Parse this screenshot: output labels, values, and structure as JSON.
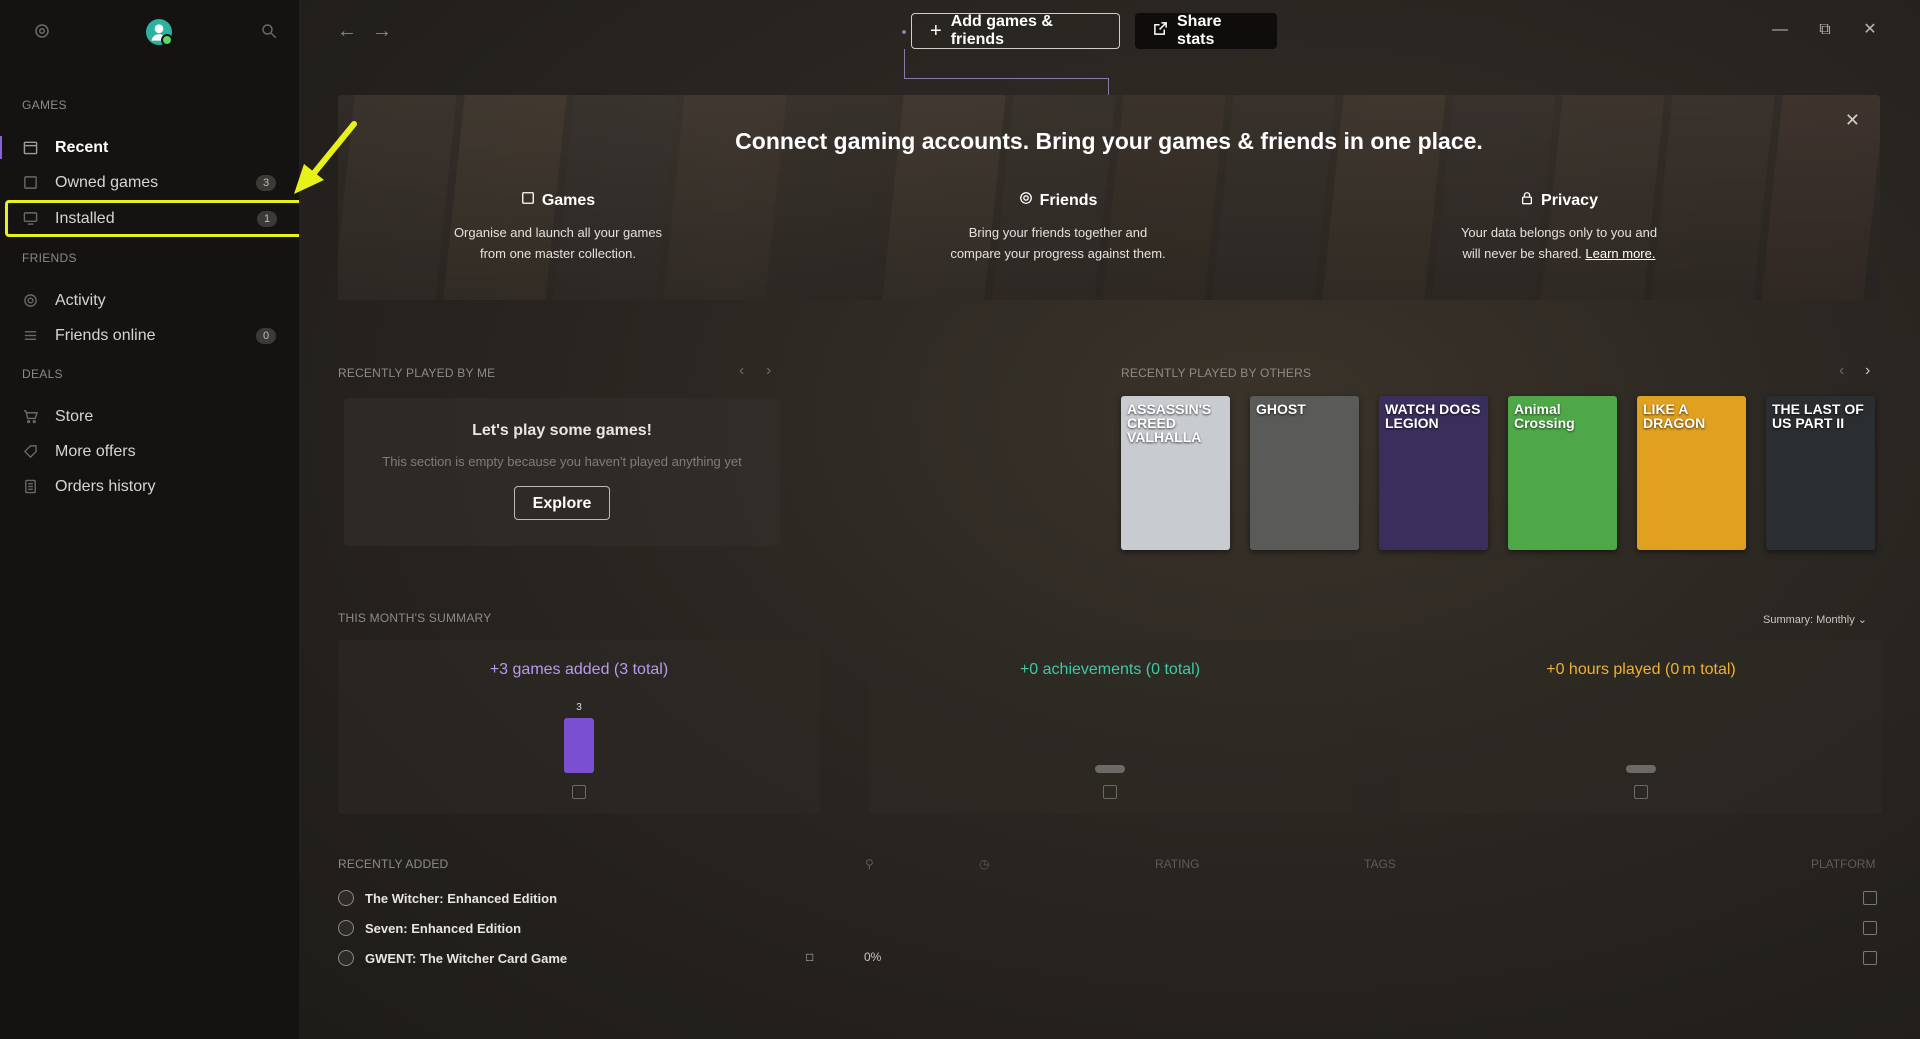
{
  "sidebar": {
    "sections": {
      "games": "GAMES",
      "friends": "FRIENDS",
      "deals": "DEALS"
    },
    "games": [
      {
        "label": "Recent",
        "icon": "calendar-icon"
      },
      {
        "label": "Owned games",
        "icon": "square-icon",
        "count": "3"
      },
      {
        "label": "Installed",
        "icon": "monitor-icon",
        "count": "1"
      }
    ],
    "friends": [
      {
        "label": "Activity",
        "icon": "activity-icon"
      },
      {
        "label": "Friends online",
        "icon": "list-icon",
        "count": "0"
      }
    ],
    "deals": [
      {
        "label": "Store",
        "icon": "cart-icon"
      },
      {
        "label": "More offers",
        "icon": "tag-icon"
      },
      {
        "label": "Orders history",
        "icon": "receipt-icon"
      }
    ]
  },
  "topbar": {
    "add_label": "Add games & friends",
    "share_label": "Share stats"
  },
  "banner": {
    "title": "Connect gaming accounts. Bring your games & friends in one place.",
    "features": [
      {
        "title": "Games",
        "line1": "Organise and launch all your games",
        "line2": "from one master collection."
      },
      {
        "title": "Friends",
        "line1": "Bring your friends together and",
        "line2": "compare your progress against them."
      },
      {
        "title": "Privacy",
        "line1": "Your data belongs only to you and",
        "line2": "will never be shared.",
        "link": "Learn more."
      }
    ]
  },
  "recently_played_me": {
    "heading": "RECENTLY PLAYED BY ME",
    "empty_title": "Let's play some games!",
    "empty_desc": "This section is empty because you haven't played anything yet",
    "button": "Explore"
  },
  "recently_played_others": {
    "heading": "RECENTLY PLAYED BY OTHERS",
    "covers": [
      {
        "title": "ASSASSIN'S CREED VALHALLA",
        "color": "#c8ccd0"
      },
      {
        "title": "GHOST",
        "color": "#5a5a58"
      },
      {
        "title": "WATCH DOGS LEGION",
        "color": "#3a2f5c"
      },
      {
        "title": "Animal Crossing",
        "color": "#4fa848"
      },
      {
        "title": "LIKE A DRAGON",
        "color": "#e0a020"
      },
      {
        "title": "THE LAST OF US PART II",
        "color": "#2a2e30"
      }
    ]
  },
  "summary": {
    "heading": "THIS MONTH'S SUMMARY",
    "selector": "Summary: Monthly",
    "cards": [
      {
        "title": "+3 games added (3 total)",
        "color": "#b89af0",
        "bar_value": "3"
      },
      {
        "title": "+0 achievements (0 total)",
        "color": "#3ec9a8"
      },
      {
        "title": "+0 hours played (0 m total)",
        "color": "#f0b030"
      }
    ]
  },
  "recently_added": {
    "heading": "RECENTLY ADDED",
    "columns": {
      "rating": "RATING",
      "tags": "TAGS",
      "platform": "PLATFORM"
    },
    "rows": [
      {
        "name": "The Witcher: Enhanced Edition",
        "progress": ""
      },
      {
        "name": "Seven: Enhanced Edition",
        "progress": ""
      },
      {
        "name": "GWENT: The Witcher Card Game",
        "progress": "0%"
      }
    ]
  }
}
